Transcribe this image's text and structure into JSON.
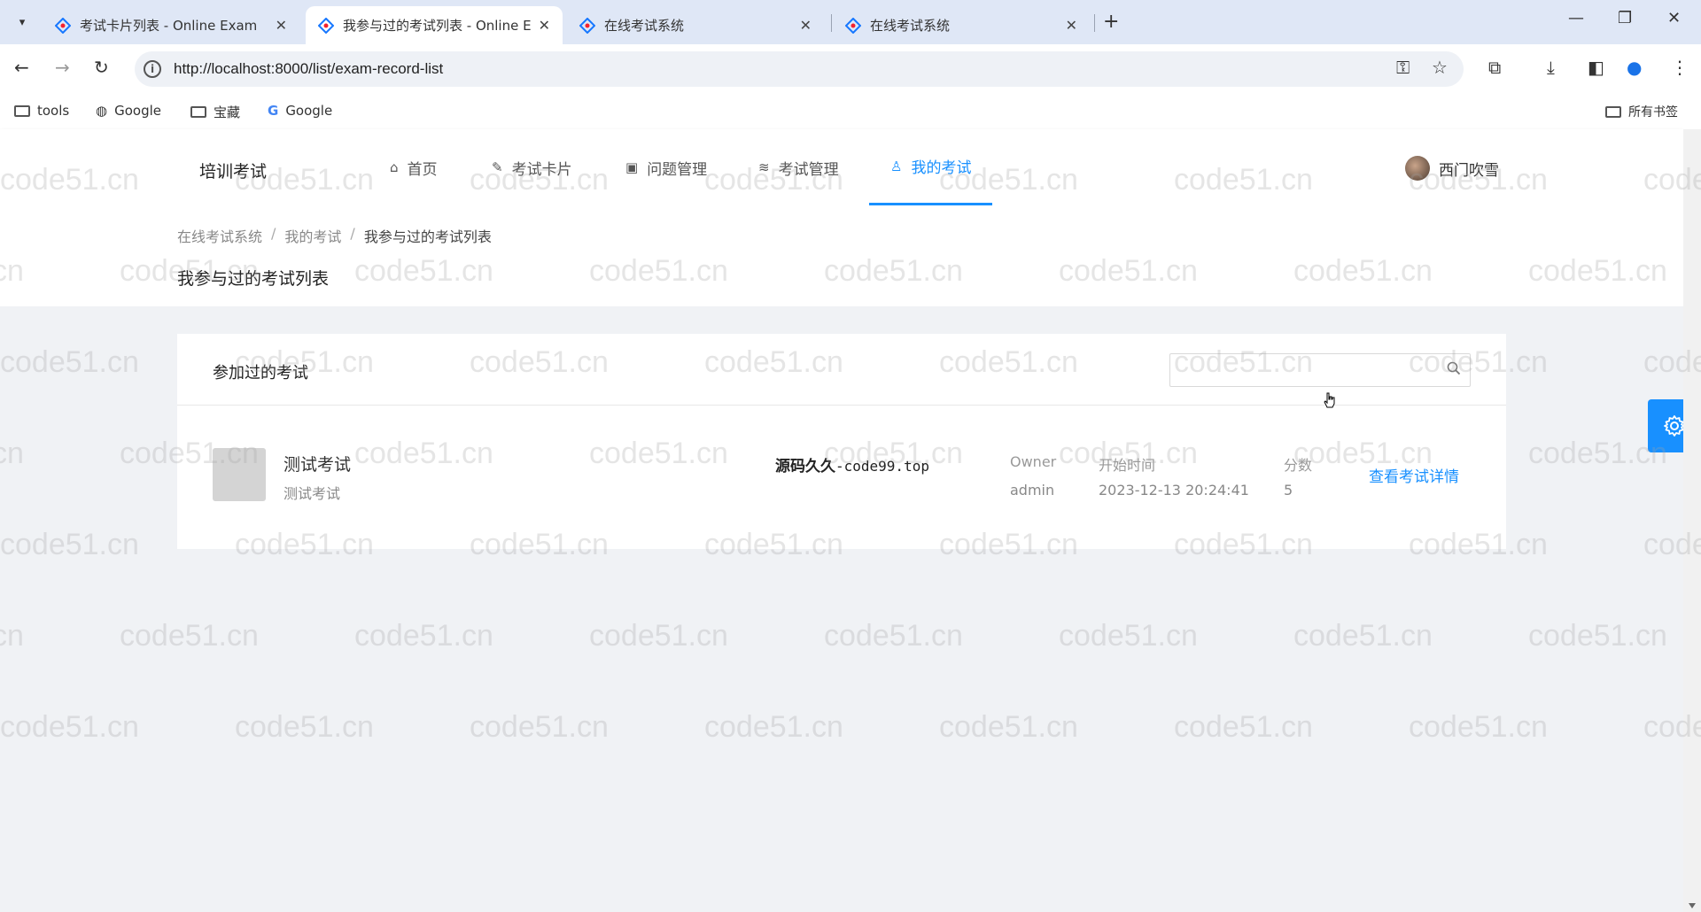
{
  "browser": {
    "tabs": [
      {
        "title": "考试卡片列表 - Online Exam",
        "active": false
      },
      {
        "title": "我参与过的考试列表 - Online E",
        "active": true
      },
      {
        "title": "在线考试系统",
        "active": false
      },
      {
        "title": "在线考试系统",
        "active": false
      }
    ],
    "url": "http://localhost:8000/list/exam-record-list",
    "bookmarks": [
      {
        "label": "tools",
        "icon": "folder-icon"
      },
      {
        "label": "Google",
        "icon": "globe-icon"
      },
      {
        "label": "宝藏",
        "icon": "folder-icon"
      },
      {
        "label": "Google",
        "icon": "google-icon"
      }
    ],
    "all_bookmarks_label": "所有书签"
  },
  "header": {
    "logo": "培训考试",
    "menu": [
      {
        "label": "首页",
        "icon": "home-icon"
      },
      {
        "label": "考试卡片",
        "icon": "card-icon"
      },
      {
        "label": "问题管理",
        "icon": "question-icon"
      },
      {
        "label": "考试管理",
        "icon": "layers-icon"
      },
      {
        "label": "我的考试",
        "icon": "user-icon",
        "active": true
      }
    ],
    "user_name": "西门吹雪"
  },
  "breadcrumb": [
    "在线考试系统",
    "我的考试",
    "我参与过的考试列表"
  ],
  "page_title": "我参与过的考试列表",
  "card": {
    "title": "参加过的考试",
    "search_placeholder": ""
  },
  "records": [
    {
      "name": "测试考试",
      "description": "测试考试",
      "promo_text": "源码久久",
      "promo_code": "-code99.top",
      "owner_label": "Owner",
      "owner": "admin",
      "start_label": "开始时间",
      "start_time": "2023-12-13 20:24:41",
      "score_label": "分数",
      "score": "5",
      "action": "查看考试详情"
    }
  ],
  "watermark_text": "code51.cn",
  "colors": {
    "accent": "#1890ff",
    "page_bg": "#f0f2f5",
    "tabstrip_bg": "#dfe7f6"
  }
}
